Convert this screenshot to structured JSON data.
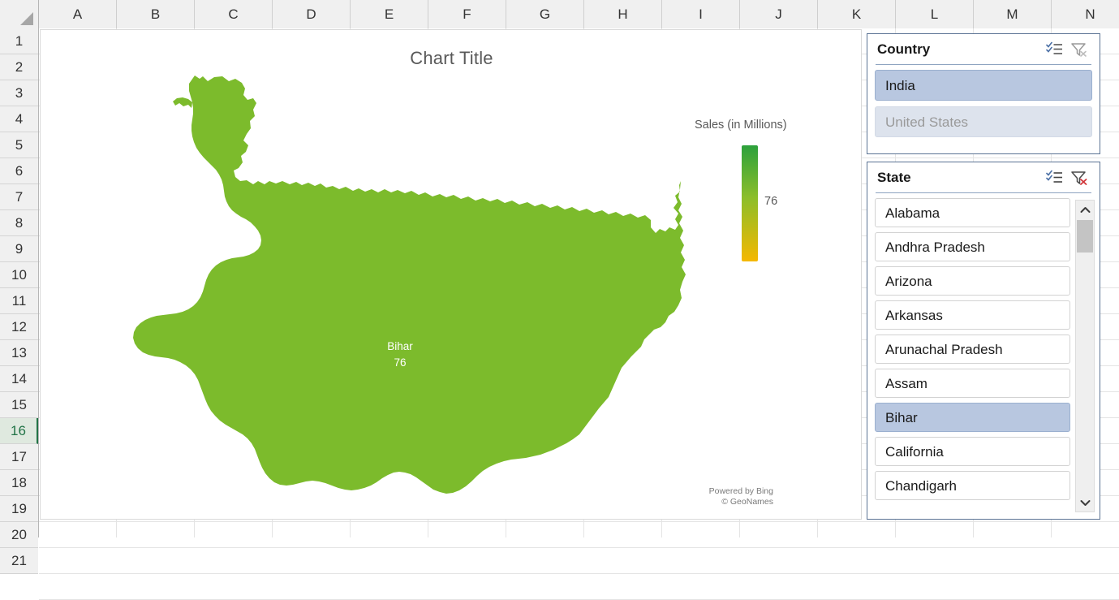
{
  "spreadsheet": {
    "columns": [
      "A",
      "B",
      "C",
      "D",
      "E",
      "F",
      "G",
      "H",
      "I",
      "J",
      "K",
      "L",
      "M",
      "N"
    ],
    "rows": [
      "1",
      "2",
      "3",
      "4",
      "5",
      "6",
      "7",
      "8",
      "9",
      "10",
      "11",
      "12",
      "13",
      "14",
      "15",
      "16",
      "17",
      "18",
      "19",
      "20",
      "21"
    ],
    "active_row": "16",
    "select_all_icon": "select-all-triangle"
  },
  "chart": {
    "title": "Chart Title",
    "map_label_name": "Bihar",
    "map_label_value": "76",
    "legend_title": "Sales (in Millions)",
    "legend_value": "76",
    "legend_gradient_top": "#2ca13c",
    "legend_gradient_bottom": "#f5b800",
    "region_fill": "#7cbb2c",
    "attribution_line1": "Powered by Bing",
    "attribution_line2": "© GeoNames"
  },
  "chart_data": {
    "type": "map",
    "title": "Chart Title",
    "legend_title": "Sales (in Millions)",
    "regions": [
      {
        "name": "Bihar",
        "value": 76,
        "color": "#7cbb2c"
      }
    ],
    "value_scale_min_label": "",
    "value_scale_max_label": "76",
    "colorscale": [
      "#f5b800",
      "#7cbb2c",
      "#2ca13c"
    ],
    "legend_position": "right",
    "attribution": "Powered by Bing © GeoNames"
  },
  "country_slicer": {
    "title": "Country",
    "multiselect_icon": "multi-select-icon",
    "clear_filter_icon": "clear-filter-icon",
    "clear_filter_active": false,
    "items": [
      {
        "label": "India",
        "state": "selected"
      },
      {
        "label": "United States",
        "state": "disabled"
      }
    ]
  },
  "state_slicer": {
    "title": "State",
    "multiselect_icon": "multi-select-icon",
    "clear_filter_icon": "clear-filter-icon",
    "clear_filter_active": true,
    "items": [
      {
        "label": "Alabama",
        "state": "normal"
      },
      {
        "label": "Andhra Pradesh",
        "state": "normal"
      },
      {
        "label": "Arizona",
        "state": "normal"
      },
      {
        "label": "Arkansas",
        "state": "normal"
      },
      {
        "label": "Arunachal Pradesh",
        "state": "normal"
      },
      {
        "label": "Assam",
        "state": "normal"
      },
      {
        "label": "Bihar",
        "state": "selected"
      },
      {
        "label": "California",
        "state": "normal"
      },
      {
        "label": "Chandigarh",
        "state": "normal"
      }
    ],
    "scroll_up_icon": "chevron-up-icon",
    "scroll_down_icon": "chevron-down-icon"
  }
}
